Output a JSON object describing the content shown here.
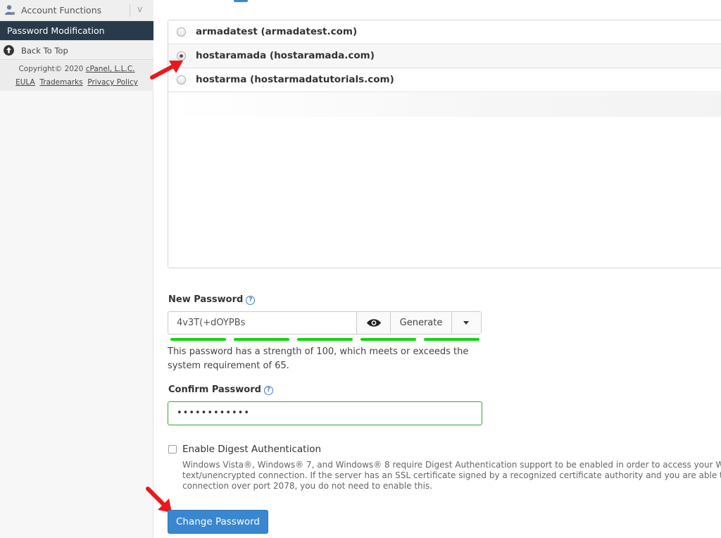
{
  "sidebar": {
    "group_label": "Account Functions",
    "group_toggle": "v",
    "active_item": "Password Modification",
    "back_to_top": "Back To Top",
    "footer": {
      "copyright": "Copyright© 2020",
      "company": "cPanel, L.L.C.",
      "eula": "EULA",
      "trademarks": "Trademarks",
      "privacy": "Privacy Policy"
    }
  },
  "domains": [
    {
      "label": "armadatest (armadatest.com)",
      "selected": false
    },
    {
      "label": "hostaramada (hostaramada.com)",
      "selected": true
    },
    {
      "label": "hostarma (hostarmadatutorials.com)",
      "selected": false
    }
  ],
  "form": {
    "new_password_label": "New Password",
    "new_password_value": "4v3T(+dOYPBs",
    "generate_label": "Generate",
    "strength_text": "This password has a strength of 100, which meets or exceeds the system requirement of 65.",
    "strength_percent": 100,
    "confirm_label": "Confirm Password",
    "confirm_value": "••••••••••••",
    "digest_label": "Enable Digest Authentication",
    "digest_desc_1": "Windows Vista®, Windows® 7, and Windows® 8 require Digest Authentication support to be enabled in order to access your W",
    "digest_desc_2": "text/unencrypted connection. If the server has an SSL certificate signed by a recognized certificate authority and you are able to",
    "digest_desc_3": "connection over port 2078, you do not need to enable this.",
    "submit_label": "Change Password",
    "help_glyph": "?"
  },
  "colors": {
    "accent": "#3a87cf",
    "sidebar_active": "#293a4a",
    "strength": "#11d611",
    "arrow": "#e8191e"
  }
}
